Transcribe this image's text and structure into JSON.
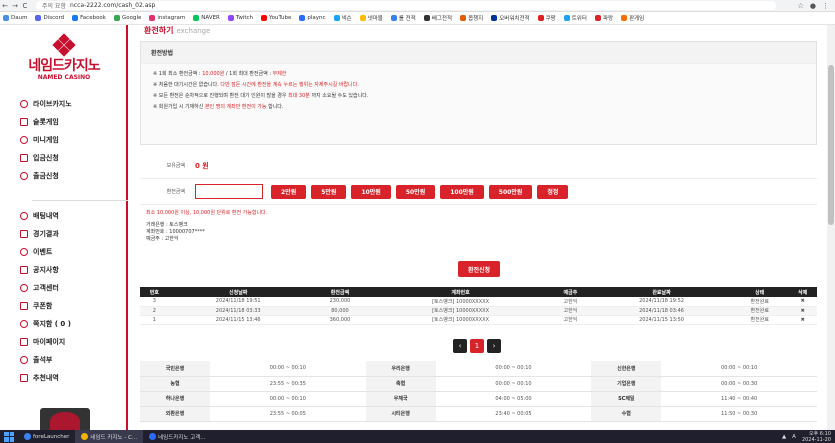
{
  "browser": {
    "url": "ncca-2222.com/cash_02.asp",
    "security": "주의 요함",
    "back": "←",
    "forward": "→",
    "reload": "C"
  },
  "bookmarks": [
    {
      "label": "Daum",
      "color": "#4a90e2"
    },
    {
      "label": "Discord",
      "color": "#5865f2"
    },
    {
      "label": "Facebook",
      "color": "#1877f2"
    },
    {
      "label": "Google",
      "color": "#34a853"
    },
    {
      "label": "instagram",
      "color": "#e1306c"
    },
    {
      "label": "NAVER",
      "color": "#03c75a"
    },
    {
      "label": "Twitch",
      "color": "#9146ff"
    },
    {
      "label": "YouTube",
      "color": "#ff0000"
    },
    {
      "label": "plaync",
      "color": "#2b6cff"
    },
    {
      "label": "넥슨",
      "color": "#1aa3ff"
    },
    {
      "label": "넷마블",
      "color": "#ffbb00"
    },
    {
      "label": "롤 전적",
      "color": "#3b82f6"
    },
    {
      "label": "배그전적",
      "color": "#333333"
    },
    {
      "label": "옵챙지",
      "color": "#e35d00"
    },
    {
      "label": "오버워치전적",
      "color": "#003399"
    },
    {
      "label": "쿠팡",
      "color": "#e02020"
    },
    {
      "label": "트위터",
      "color": "#1da1f2"
    },
    {
      "label": "파랑",
      "color": "#d62828"
    },
    {
      "label": "판게임",
      "color": "#ff6f00"
    }
  ],
  "logo": {
    "title": "네임드카지노",
    "subtitle": "NAMED CASINO"
  },
  "menu_top": [
    {
      "label": "라이브카지노",
      "icon": "casino-chip-icon"
    },
    {
      "label": "슬롯게임",
      "icon": "slot-icon"
    },
    {
      "label": "미니게임",
      "icon": "mini-game-icon"
    },
    {
      "label": "입금신청",
      "icon": "deposit-icon"
    },
    {
      "label": "출금신청",
      "icon": "withdraw-icon"
    }
  ],
  "menu_bottom": [
    {
      "label": "배팅내역",
      "icon": "list-icon"
    },
    {
      "label": "경기결과",
      "icon": "trophy-icon"
    },
    {
      "label": "이벤트",
      "icon": "gift-icon"
    },
    {
      "label": "공지사항",
      "icon": "megaphone-icon"
    },
    {
      "label": "고객센터",
      "icon": "headset-icon"
    },
    {
      "label": "쿠폰함",
      "icon": "coupon-icon"
    },
    {
      "label": "쪽지함 ( 0 )",
      "icon": "mail-icon"
    },
    {
      "label": "마이페이지",
      "icon": "user-icon"
    },
    {
      "label": "출석부",
      "icon": "calendar-icon"
    },
    {
      "label": "추천내역",
      "icon": "users-icon"
    }
  ],
  "page": {
    "title": "환전하기",
    "subtitle": "exchange"
  },
  "method": {
    "title": "환전방법",
    "lines": [
      {
        "pre": "※ 1회 최소 환전금액 : ",
        "red": "10,000원",
        "mid": " / 1회 최대 환전금액 : ",
        "red2": "무제한",
        "post": ""
      },
      {
        "pre": "※ 처음한 대기시간은 없습니다. ",
        "red": "다만 잠든 시간에 환전을 계속 누르는 행위는 자제주시길 바랍니다.",
        "mid": "",
        "red2": "",
        "post": ""
      },
      {
        "pre": "※ 모든 환전은 순차적으로 진행되며 환전 대기 인원이 많을 경우 ",
        "red": "최대 30분",
        "mid": " 까지 소요될 수도 있습니다.",
        "red2": "",
        "post": ""
      },
      {
        "pre": "※ 회원가입 시 기재하신 ",
        "red": "본인 명의 계좌만 환전이 가능",
        "mid": " 합니다.",
        "red2": "",
        "post": ""
      }
    ]
  },
  "form": {
    "balance_label": "보유금액",
    "balance_value": "0 원",
    "amount_label": "환전금액",
    "amount_value": "",
    "chips": [
      "2만원",
      "5만원",
      "10만원",
      "50만원",
      "100만원",
      "500만원",
      "정정"
    ],
    "hint": "최소 10,000원 이상, 10,000원 단위로 환전 가능합니다.",
    "bank_line": "거래은행 : 토스뱅크",
    "account_line": "계좌번호 : 10000707****",
    "holder_line": "예금주 : 고한익",
    "apply_label": "환전신청"
  },
  "history": {
    "headers": [
      "번호",
      "신청날짜",
      "환전금액",
      "계좌번호",
      "예금주",
      "완료날짜",
      "상태",
      "삭제"
    ],
    "rows": [
      [
        "3",
        "2024/11/18 19:51",
        "230,000",
        "[토스뱅크] 10000XXXXX",
        "고한익",
        "2024/11/18 19:52",
        "환전완료",
        "✖"
      ],
      [
        "2",
        "2024/11/18 03:33",
        "80,000",
        "[토스뱅크] 10000XXXXX",
        "고한익",
        "2024/11/18 03:46",
        "환전완료",
        "✖"
      ],
      [
        "1",
        "2024/11/15 13:46",
        "360,000",
        "[토스뱅크] 10000XXXXX",
        "고한익",
        "2024/11/15 13:50",
        "환전완료",
        "✖"
      ]
    ],
    "prev": "‹",
    "page": "1",
    "next": "›"
  },
  "banks": [
    [
      "국민은행",
      "00:00 ~ 00:10",
      "우리은행",
      "00:00 ~ 00:10",
      "신한은행",
      "00:00 ~ 00:10"
    ],
    [
      "농협",
      "23:55 ~ 00:35",
      "축협",
      "00:00 ~ 00:10",
      "기업은행",
      "00:00 ~ 00:30"
    ],
    [
      "하나은행",
      "00:00 ~ 00:10",
      "우체국",
      "04:00 ~ 05:00",
      "SC제일",
      "11:40 ~ 00:40"
    ],
    [
      "외환은행",
      "23:55 ~ 00:05",
      "시티은행",
      "23:40 ~ 00:05",
      "수협",
      "11:50 ~ 00:30"
    ]
  ],
  "taskbar": {
    "apps": [
      {
        "label": "foreLauncher",
        "color": "#3b82f6"
      },
      {
        "label": "네임드 카지노 - C...",
        "color": "#f4b400"
      },
      {
        "label": "네임드카지노 고객...",
        "color": "#2b6cff"
      }
    ],
    "time": "오후 6:10",
    "date": "2024-11-20",
    "lang": "A"
  }
}
